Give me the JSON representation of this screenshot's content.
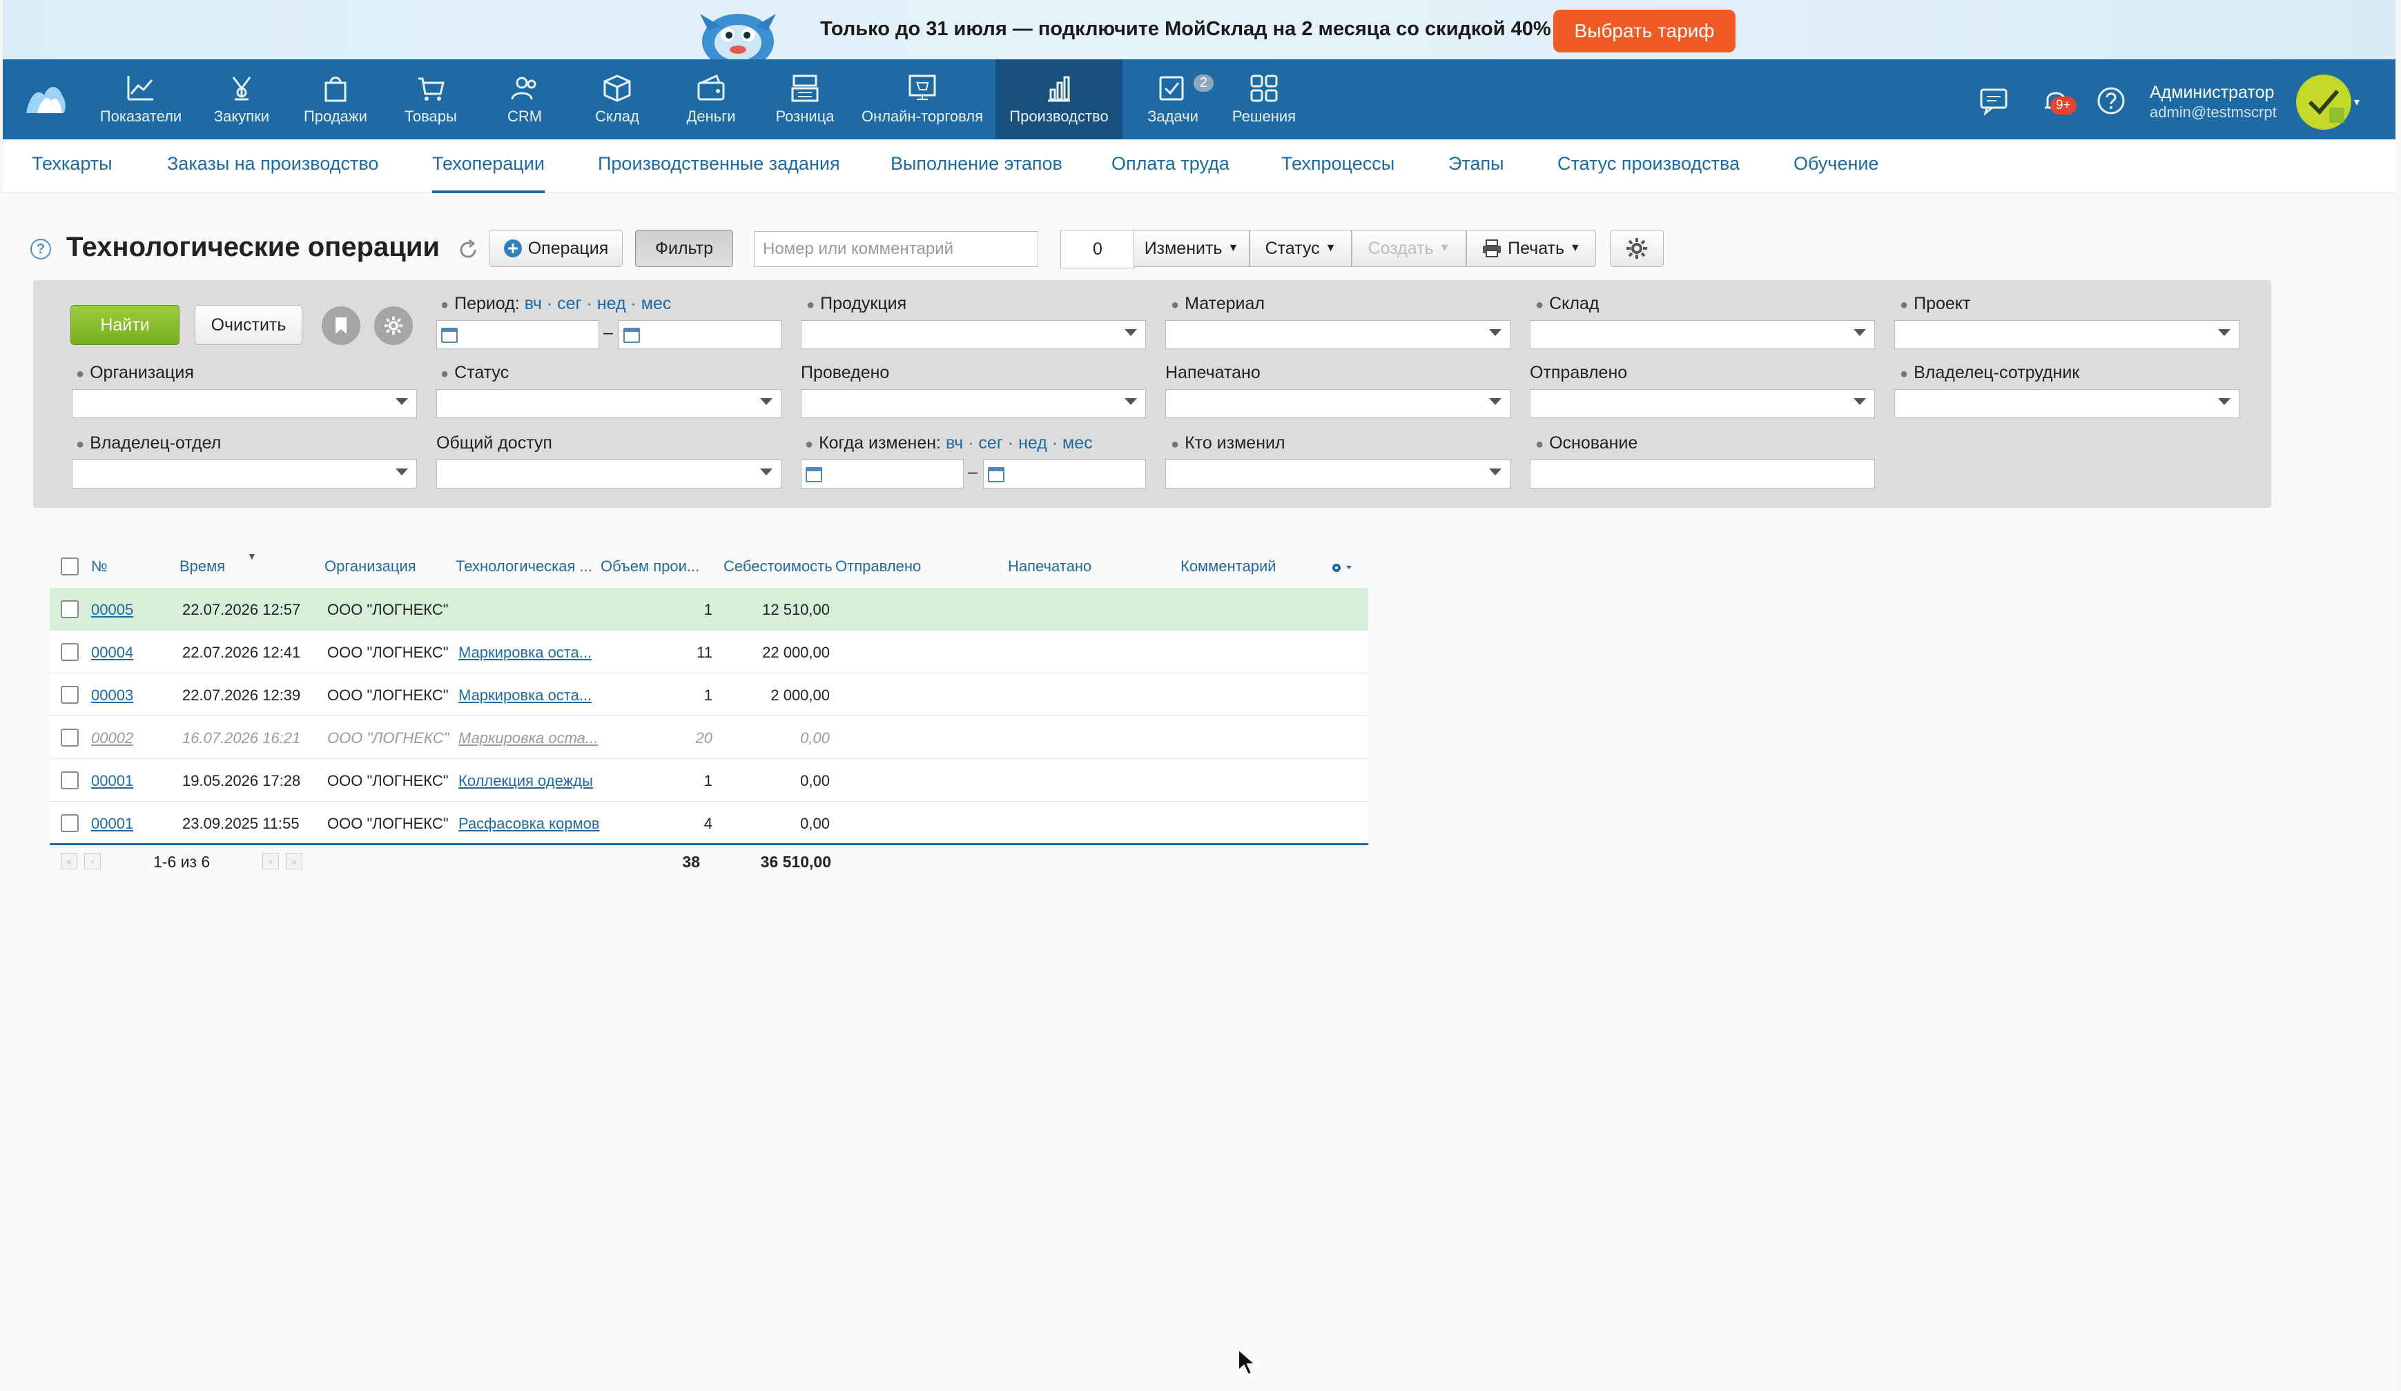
{
  "promo": {
    "text": "Только до 31 июля — подключите МойСклад на 2 месяца со скидкой 40%",
    "button": "Выбрать тариф"
  },
  "nav": {
    "items": [
      {
        "label": "Показатели",
        "icon": "chart-line-icon"
      },
      {
        "label": "Закупки",
        "icon": "purchases-icon"
      },
      {
        "label": "Продажи",
        "icon": "bag-icon"
      },
      {
        "label": "Товары",
        "icon": "cart-icon"
      },
      {
        "label": "CRM",
        "icon": "users-icon"
      },
      {
        "label": "Склад",
        "icon": "box-icon"
      },
      {
        "label": "Деньги",
        "icon": "wallet-icon"
      },
      {
        "label": "Розница",
        "icon": "register-icon"
      },
      {
        "label": "Онлайн-торговля",
        "icon": "online-store-icon"
      },
      {
        "label": "Производство",
        "icon": "bar-chart-icon"
      },
      {
        "label": "Задачи",
        "icon": "tasks-icon"
      },
      {
        "label": "Решения",
        "icon": "apps-icon"
      }
    ],
    "tasks_badge": "2",
    "notif_badge": "9+",
    "user_name": "Администратор",
    "user_email": "admin@testmscrpt"
  },
  "subnav": [
    "Техкарты",
    "Заказы на производство",
    "Техоперации",
    "Производственные задания",
    "Выполнение этапов",
    "Оплата труда",
    "Техпроцессы",
    "Этапы",
    "Статус производства",
    "Обучение"
  ],
  "header": {
    "title": "Технологические операции",
    "help": "?",
    "operation_btn": "Операция",
    "filter_btn": "Фильтр",
    "search_placeholder": "Номер или комментарий",
    "selected_count": "0",
    "change_btn": "Изменить",
    "status_btn": "Статус",
    "create_btn": "Создать",
    "print_btn": "Печать"
  },
  "filters": {
    "find": "Найти",
    "clear": "Очистить",
    "period": "Период:",
    "quick_dates": "вч · сег · нед · мес",
    "product": "Продукция",
    "material": "Материал",
    "warehouse": "Склад",
    "project": "Проект",
    "organization": "Организация",
    "status": "Статус",
    "posted": "Проведено",
    "printed": "Напечатано",
    "sent": "Отправлено",
    "owner_employee": "Владелец-сотрудник",
    "owner_department": "Владелец-отдел",
    "shared": "Общий доступ",
    "changed_when": "Когда изменен:",
    "changed_by": "Кто изменил",
    "basis": "Основание",
    "dash": "–"
  },
  "table": {
    "headers": {
      "num": "№",
      "time": "Время",
      "org": "Организация",
      "tech": "Технологическая ...",
      "volume": "Объем прои...",
      "cost": "Себестоимость",
      "sent": "Отправлено",
      "printed": "Напечатано",
      "comment": "Комментарий"
    },
    "rows": [
      {
        "num": "00005",
        "time": "22.07.2026 12:57",
        "org": "ООО \"ЛОГНЕКС\"",
        "tech": "",
        "volume": "1",
        "cost": "12 510,00"
      },
      {
        "num": "00004",
        "time": "22.07.2026 12:41",
        "org": "ООО \"ЛОГНЕКС\"",
        "tech": "Маркировка оста...",
        "volume": "11",
        "cost": "22 000,00"
      },
      {
        "num": "00003",
        "time": "22.07.2026 12:39",
        "org": "ООО \"ЛОГНЕКС\"",
        "tech": "Маркировка оста...",
        "volume": "1",
        "cost": "2 000,00"
      },
      {
        "num": "00002",
        "time": "16.07.2026 16:21",
        "org": "ООО \"ЛОГНЕКС\"",
        "tech": "Маркировка оста...",
        "volume": "20",
        "cost": "0,00"
      },
      {
        "num": "00001",
        "time": "19.05.2026 17:28",
        "org": "ООО \"ЛОГНЕКС\"",
        "tech": "Коллекция одежды",
        "volume": "1",
        "cost": "0,00"
      },
      {
        "num": "00001",
        "time": "23.09.2025 11:55",
        "org": "ООО \"ЛОГНЕКС\"",
        "tech": "Расфасовка кормов",
        "volume": "4",
        "cost": "0,00"
      }
    ],
    "pager": "1-6 из 6",
    "total_volume": "38",
    "total_cost": "36 510,00"
  },
  "colors": {
    "nav_bg": "#1e6aa5",
    "nav_active": "#174f7d",
    "promo_btn": "#f15a24",
    "find_btn": "#8cc132",
    "selected_row": "#d7eed8"
  }
}
